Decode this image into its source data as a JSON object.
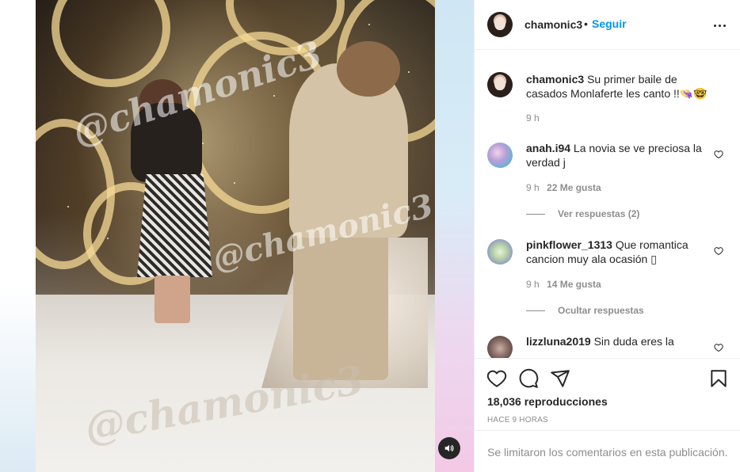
{
  "post": {
    "author": {
      "username": "chamonic3",
      "avatar_icon": "profile-avatar-icon"
    },
    "follow_label": "Seguir",
    "separator": "•",
    "caption_username": "chamonic3",
    "caption_text": "Su primer baile de casados Monlaferte les canto !!👒🤓",
    "caption_time": "9 h"
  },
  "video": {
    "watermark": "@chamonic3",
    "mute_icon": "speaker-icon"
  },
  "comments": [
    {
      "username": "anah.i94",
      "text": "La novia se ve preciosa la verdad j",
      "time": "9 h",
      "likes": "22 Me gusta",
      "replies_label": "Ver respuestas (2)"
    },
    {
      "username": "pinkflower_1313",
      "text": "Que romantica cancion muy ala ocasión ▯",
      "time": "9 h",
      "likes": "14 Me gusta",
      "replies_label": "Ocultar respuestas"
    },
    {
      "username": "lizzluna2019",
      "text": "Sin duda eres la",
      "time": "",
      "likes": "",
      "replies_label": ""
    }
  ],
  "actions": {
    "icons": [
      "heart-icon",
      "comment-icon",
      "share-icon",
      "bookmark-icon"
    ],
    "views": "18,036 reproducciones",
    "time_ago": "HACE 9 HORAS",
    "comments_disabled": "Se limitaron los comentarios en esta publicación."
  },
  "colors": {
    "accent": "#0095f6",
    "muted": "#8e8e8e",
    "text": "#262626"
  }
}
